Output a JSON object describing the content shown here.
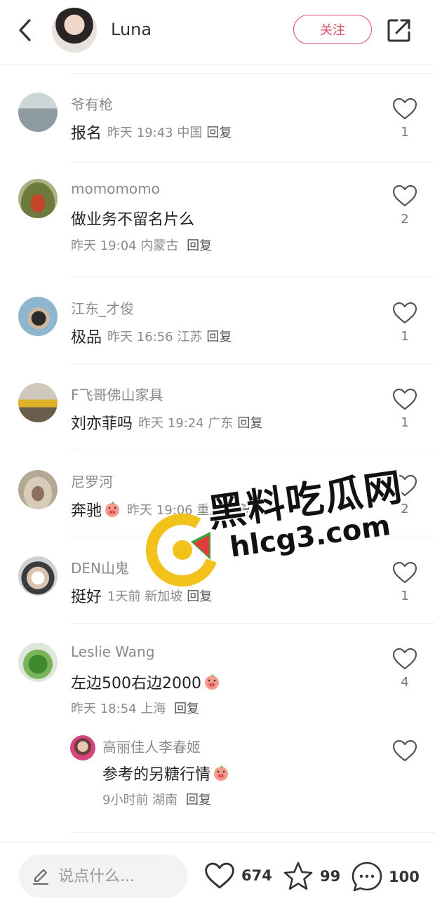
{
  "header": {
    "user_name": "Luna",
    "follow_label": "关注"
  },
  "comments": [
    {
      "user": "爷有枪",
      "text": "报名",
      "meta": "昨天 19:43 中国",
      "reply": "回复",
      "likes": "1"
    },
    {
      "user": "momomomo",
      "text": "做业务不留名片么",
      "meta": "昨天 19:04 内蒙古",
      "reply": "回复",
      "likes": "2"
    },
    {
      "user": "江东_才俊",
      "text": "极品",
      "meta": "昨天 16:56 江苏",
      "reply": "回复",
      "likes": "1"
    },
    {
      "user": "F飞哥佛山家具",
      "text": "刘亦菲吗",
      "meta": "昨天 19:24 广东",
      "reply": "回复",
      "likes": "1"
    },
    {
      "user": "尼罗河",
      "text": "奔驰",
      "meta": "昨天 19:06 重庆",
      "reply": "回复",
      "likes": "2"
    },
    {
      "user": "DEN山鬼",
      "text": "挺好",
      "meta": "1天前  新加坡",
      "reply": "回复",
      "likes": "1"
    },
    {
      "user": "Leslie Wang",
      "text": "左边500右边2000",
      "meta": "昨天 18:54 上海",
      "reply": "回复",
      "likes": "4"
    }
  ],
  "sub_reply": {
    "user": "高丽佳人李春姬",
    "text": "参考的另糖行情",
    "meta": "9小时前  湖南",
    "reply": "回复"
  },
  "watermark": {
    "title": "黑料吃瓜网",
    "url": "hlcg3.com"
  },
  "bottom": {
    "input_placeholder": "说点什么...",
    "like_count": "674",
    "star_count": "99",
    "comment_count": "100"
  },
  "colors": {
    "accent": "#e24a63",
    "muted_text": "#8a8a8a"
  }
}
